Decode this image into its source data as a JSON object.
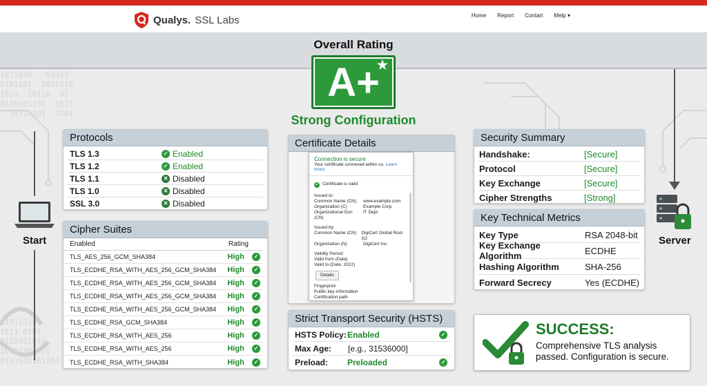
{
  "brand": {
    "name": "Qualys.",
    "product": "SSL Labs"
  },
  "nav": [
    "Home",
    "Report",
    "Contart",
    "Melp"
  ],
  "overall": {
    "title": "Overall Rating",
    "grade": "A+",
    "star": "★",
    "caption": "Strong Configuration"
  },
  "protocols": {
    "title": "Protocols",
    "rows": [
      {
        "name": "TLS 1.3",
        "status": "Enabled",
        "state": "enabled"
      },
      {
        "name": "TLS 1.2",
        "status": "Enabled",
        "state": "enabled"
      },
      {
        "name": "TLS 1.1",
        "status": "Disabled",
        "state": "disabled"
      },
      {
        "name": "TLS 1.0",
        "status": "Disabled",
        "state": "disabled"
      },
      {
        "name": "SSL 3.0",
        "status": "Disabled",
        "state": "disabled"
      }
    ]
  },
  "ciphers": {
    "title": "Cipher Suites",
    "col_enabled": "Enabled",
    "col_rating": "Rating",
    "rows": [
      {
        "name": "TLS_AES_256_GCM_SHA384",
        "rating": "High"
      },
      {
        "name": "TLS_ECDHE_RSA_WITH_AES_256_GCM_SHA384",
        "rating": "High"
      },
      {
        "name": "TLS_ECDHE_RSA_WITH_AES_256_GCM_SHA384",
        "rating": "High"
      },
      {
        "name": "TLS_ECDHE_RSA_WITH_AES_256_GCM_SHA384",
        "rating": "High"
      },
      {
        "name": "TLS_ECDHE_RSA_WITH_AES_256_GCM_SHA384",
        "rating": "High"
      },
      {
        "name": "TLS_ECDHE_RSA_GCM_SHA384",
        "rating": "High"
      },
      {
        "name": "TLS_ECDHE_RSA_WITH_AES_256",
        "rating": "High"
      },
      {
        "name": "TLS_ECDHE_RSA_WITH_AES_256",
        "rating": "High"
      },
      {
        "name": "TLS_ECDHE_RSA_WITH_SHA384",
        "rating": "High"
      }
    ]
  },
  "certificate": {
    "title": "Certificate Details",
    "secure": "Connection is secure",
    "secure_sub": "Your certificate conneved within us.",
    "learn_more": "Learn more.",
    "valid": "Certificate is valid",
    "issued_to_label": "Issued to:",
    "issued_to": [
      {
        "k": "Common Name (CN)",
        "v": "www.example.com"
      },
      {
        "k": "Organization (C)",
        "v": "Example Corp"
      },
      {
        "k": "Organizational Dun (CN)",
        "v": "IT Dept"
      }
    ],
    "issued_by_label": "Issued by:",
    "issued_by": [
      {
        "k": "Common Name (CN)",
        "v": "DigiCert Global Root G2"
      },
      {
        "k": "Organization (N)",
        "v": "DigiCert Inc."
      }
    ],
    "validity_label": "Validity Period:",
    "valid_from": "Valid from (Data)",
    "valid_to": "Valid to (Date, 2022)",
    "details_button": "Details",
    "fingerprint": "Fingerprint",
    "public_key": "Public key information",
    "cert_path": "Certification path"
  },
  "hsts": {
    "title": "Strict Transport Security (HSTS)",
    "rows": [
      {
        "k": "HSTS Policy:",
        "v": "Enabled",
        "green": true
      },
      {
        "k": "Max Age:",
        "v": "[e.g., 31536000]",
        "green": false
      },
      {
        "k": "Preload:",
        "v": "Preloaded",
        "green": true
      }
    ]
  },
  "summary": {
    "title": "Security Summary",
    "rows": [
      {
        "k": "Handshake:",
        "v": "[Secure]"
      },
      {
        "k": "Protocol",
        "v": "[Secure]"
      },
      {
        "k": "Key Exchange",
        "v": "[Secure]"
      },
      {
        "k": "Cipher Strengths",
        "v": "[Strong]"
      }
    ]
  },
  "metrics": {
    "title": "Key Technical Metrics",
    "rows": [
      {
        "k": "Key Type",
        "v": "RSA 2048-bit"
      },
      {
        "k": "Key Exchange Algorithm",
        "v": "ECDHE"
      },
      {
        "k": "Hashing Algorithm",
        "v": "SHA-256"
      },
      {
        "k": "Forward Secrecy",
        "v": "Yes (ECDHE)"
      }
    ]
  },
  "success": {
    "heading": "SUCCESS:",
    "message": "Comprehensive TLS analysis passed.  Configuration is secure."
  },
  "endpoints": {
    "start": "Start",
    "server": "Server"
  },
  "colors": {
    "accent_red": "#d7281e",
    "grade_green": "#2c9a3a",
    "ok_green": "#1e8a2a",
    "header_blue_gray": "#c6d0d9"
  }
}
